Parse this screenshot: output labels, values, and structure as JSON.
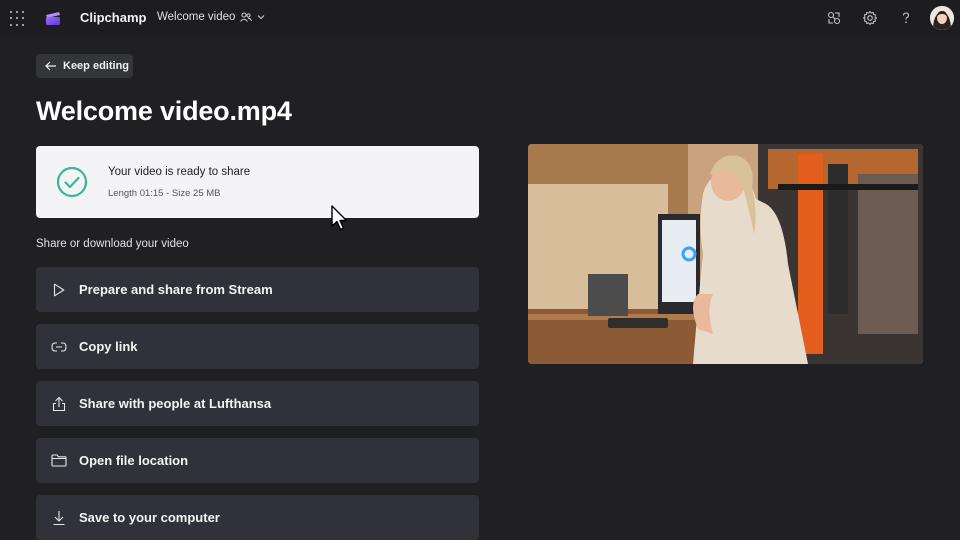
{
  "topbar": {
    "app_name": "Clipchamp",
    "doc_title": "Welcome video"
  },
  "keep_editing": {
    "label": "Keep editing"
  },
  "page": {
    "title": "Welcome video.mp4"
  },
  "status": {
    "title": "Your video is ready to share",
    "details": "Length 01:15 - Size 25 MB"
  },
  "share": {
    "section_label": "Share or download your video",
    "actions": [
      {
        "label": "Prepare and share from Stream",
        "icon": "play-icon"
      },
      {
        "label": "Copy link",
        "icon": "link-icon"
      },
      {
        "label": "Share with people at Lufthansa",
        "icon": "share-icon"
      },
      {
        "label": "Open file location",
        "icon": "folder-icon"
      },
      {
        "label": "Save to your computer",
        "icon": "download-icon"
      }
    ]
  },
  "colors": {
    "background": "#1f1f24",
    "card": "#31313a",
    "status_card": "#f4f4f6",
    "success": "#3bb59b"
  }
}
